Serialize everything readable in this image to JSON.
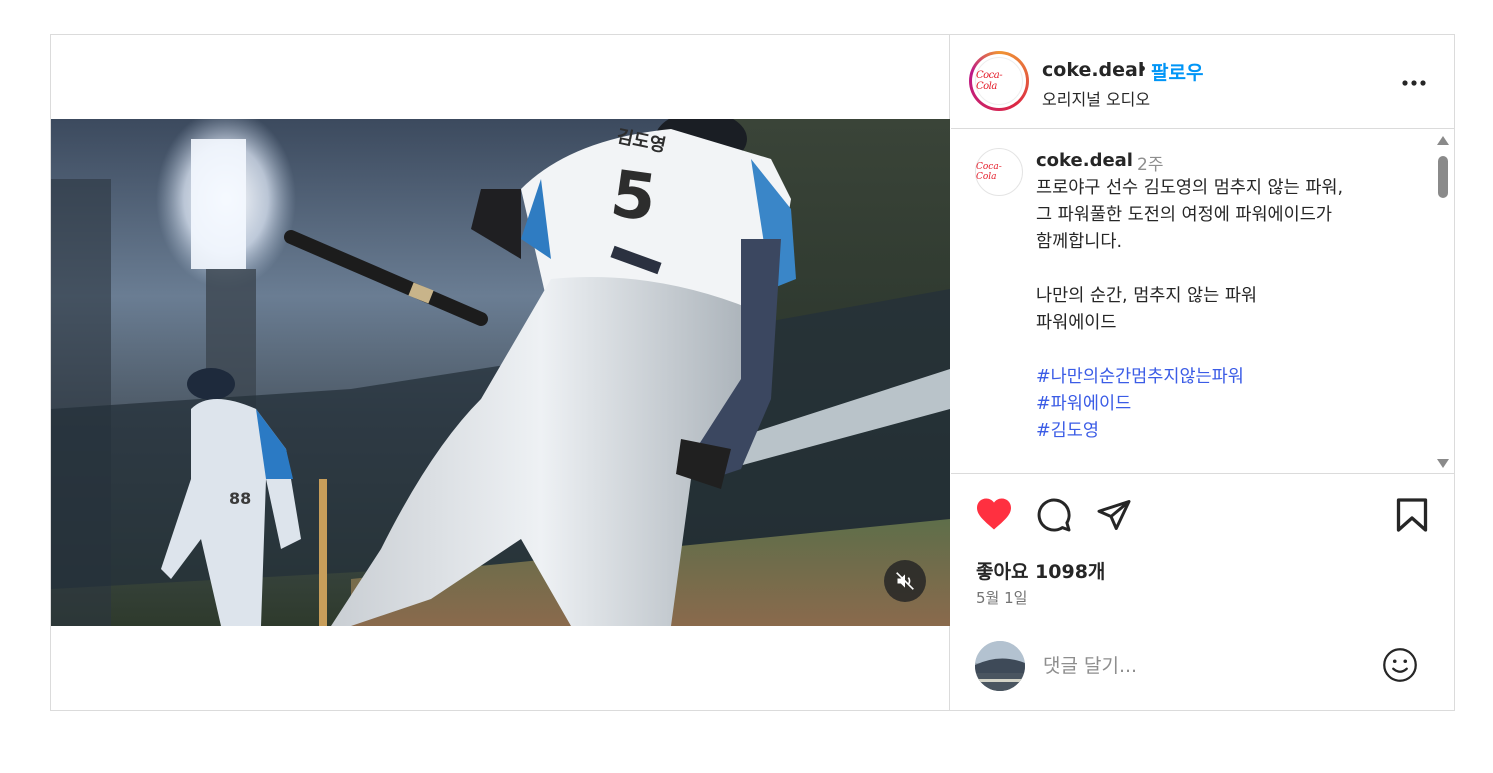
{
  "header": {
    "username": "coke.deal",
    "separator": "•",
    "follow_label": "팔로우",
    "audio_label": "오리지널 오디오",
    "avatar_logo_text": "Coca-Cola",
    "more_label": "..."
  },
  "caption": {
    "username": "coke.deal",
    "time": "2주",
    "lines": [
      "프로야구 선수 김도영의 멈추지 않는 파워,",
      "그 파워풀한 도전의 여정에 파워에이드가",
      "함께합니다.",
      "나만의 순간, 멈추지 않는 파워",
      "파워에이드"
    ],
    "hashtags": [
      "#나만의순간멈추지않는파워",
      "#파워에이드",
      "#김도영"
    ],
    "scroll_position": 0.0
  },
  "actions": {
    "liked": true,
    "like_color": "#ff3040",
    "icons": [
      "heart-icon",
      "comment-icon",
      "share-icon",
      "bookmark-icon"
    ],
    "likes_text": "좋아요 1098개",
    "date_text": "5월 1일"
  },
  "comment": {
    "placeholder": "댓글 달기...",
    "value": ""
  },
  "video": {
    "jersey_number": "5",
    "jersey_name": "김도영",
    "background_player_number": "88",
    "muted": true
  },
  "colors": {
    "follow": "#0095f6",
    "hashtag": "#3b5ce6",
    "border": "#dbdbdb",
    "text": "#262626",
    "muted_text": "#8e8e8e"
  }
}
